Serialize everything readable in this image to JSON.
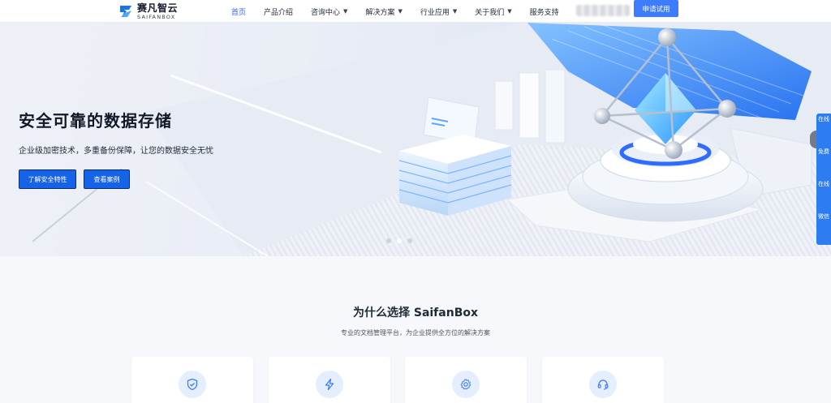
{
  "header": {
    "logo_cn": "赛凡智云",
    "logo_en": "SAIFANBOX",
    "nav": [
      {
        "label": "首页",
        "active": true
      },
      {
        "label": "产品介绍"
      },
      {
        "label": "咨询中心",
        "dropdown": true
      },
      {
        "label": "解决方案",
        "dropdown": true
      },
      {
        "label": "行业应用",
        "dropdown": true
      },
      {
        "label": "关于我们",
        "dropdown": true
      },
      {
        "label": "服务支持"
      }
    ],
    "trial_label": "申请试用",
    "caret_glyph": "▼"
  },
  "hero": {
    "title": "安全可靠的数据存储",
    "subtitle": "企业级加密技术，多重备份保障，让您的数据安全无忧",
    "buttons": [
      {
        "label": "了解安全特性"
      },
      {
        "label": "查看案例"
      }
    ],
    "active_slide": 2,
    "slide_count": 3
  },
  "side_panel": {
    "items": [
      "在线",
      "免费",
      "在线",
      "微信"
    ]
  },
  "why": {
    "title": "为什么选择 SaifanBox",
    "subtitle": "专业的文档管理平台，为企业提供全方位的解决方案",
    "cards": [
      {
        "icon": "shield-check-icon"
      },
      {
        "icon": "lightning-icon"
      },
      {
        "icon": "gear-icon"
      },
      {
        "icon": "headset-icon"
      }
    ]
  },
  "colors": {
    "accent": "#3d7bff",
    "hero_button": "#1463e8",
    "nav_active": "#2f6bff",
    "side_panel": "#2d7cf0"
  }
}
